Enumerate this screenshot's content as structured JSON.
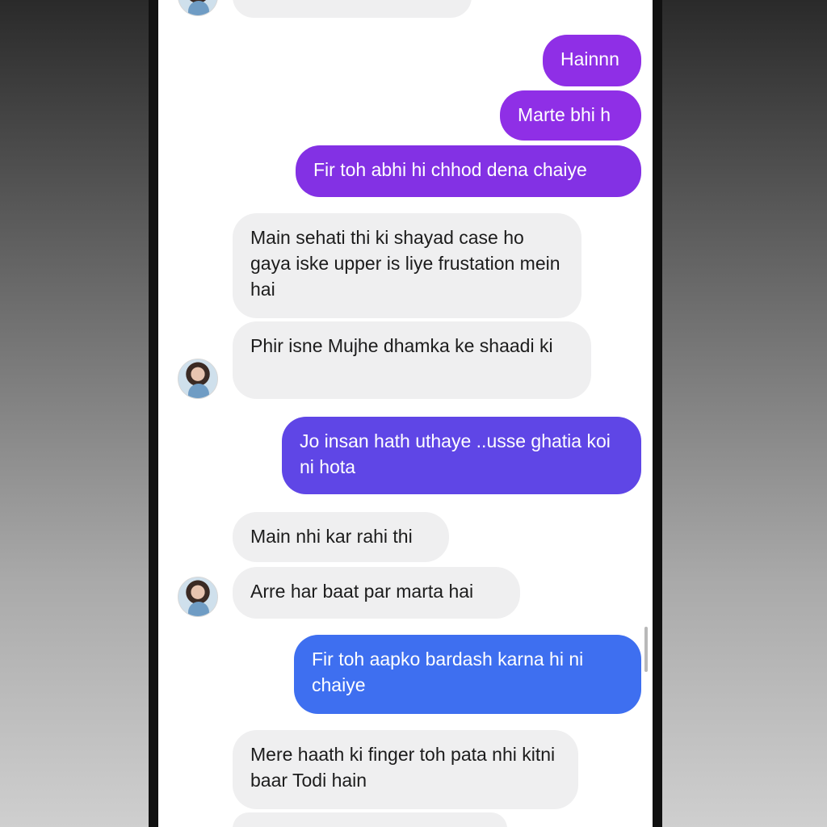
{
  "messages": [
    {
      "side": "out",
      "text": "Hainnn",
      "color": "#8f2fe6"
    },
    {
      "side": "out",
      "text": "Marte bhi h",
      "color": "#8f2fe6"
    },
    {
      "side": "out",
      "text": "Fir toh abhi hi chhod dena chaiye",
      "color": "#8331e4"
    },
    {
      "side": "in",
      "text": "Main sehati thi ki shayad case ho gaya iske upper is liye frustation mein hai"
    },
    {
      "side": "in",
      "text": "Phir isne Mujhe dhamka ke shaadi ki"
    },
    {
      "side": "out",
      "text": "Jo insan hath uthaye ..usse ghatia koi ni hota",
      "color": "#5f46e6"
    },
    {
      "side": "in",
      "text": "Main nhi kar rahi thi"
    },
    {
      "side": "in",
      "text": "Arre har baat par marta hai"
    },
    {
      "side": "out",
      "text": "Fir toh aapko bardash karna hi ni chaiye",
      "color": "#3e6ff0"
    },
    {
      "side": "in",
      "text": "Mere haath ki finger toh pata nhi kitni baar Todi hain"
    }
  ],
  "colors": {
    "incoming_bubble": "#efeff0",
    "screen_background": "#ffffff"
  },
  "icons": {
    "avatar": "contact-avatar-photo"
  }
}
